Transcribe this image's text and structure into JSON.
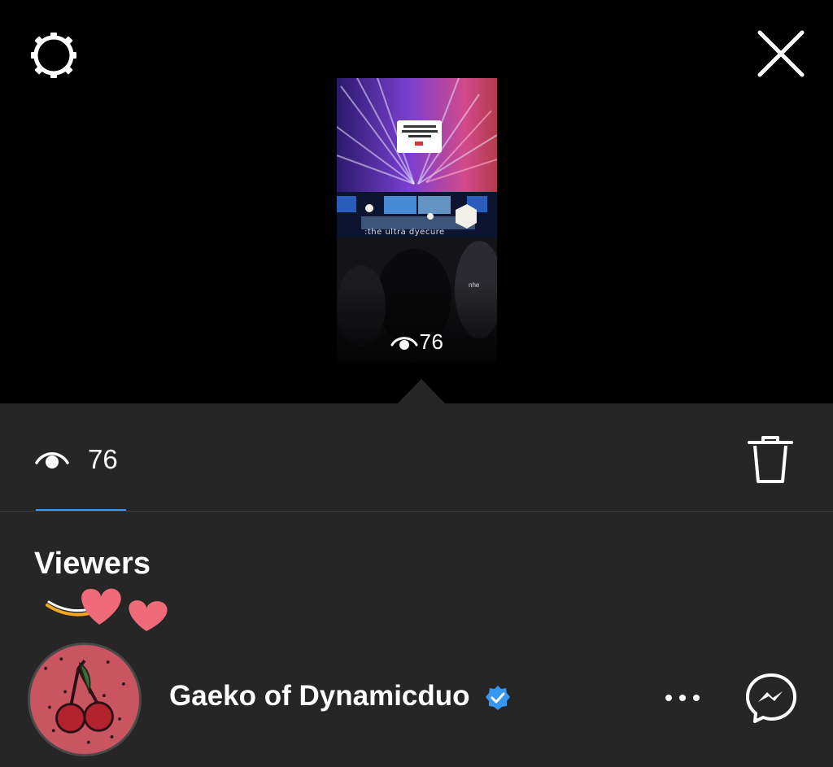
{
  "header": {
    "settings_icon": "gear-icon",
    "close_icon": "close-icon"
  },
  "story": {
    "thumb_views": "76",
    "caption": ":the ultra dyecure",
    "caption2": "nhe"
  },
  "stats": {
    "view_count": "76",
    "tab_icon": "eye-icon",
    "delete_icon": "trash-icon",
    "accent_color": "#3897f0"
  },
  "viewers": {
    "heading": "Viewers",
    "items": [
      {
        "username": "Gaeko of Dynamicduo",
        "verified": true,
        "more_icon": "more-icon",
        "message_icon": "messenger-icon"
      }
    ]
  }
}
